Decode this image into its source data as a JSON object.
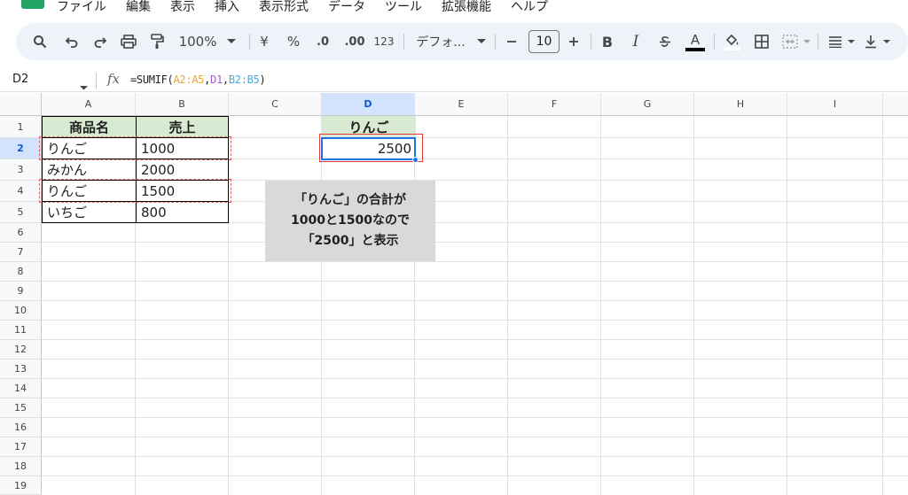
{
  "menu": {
    "items": [
      "ファイル",
      "編集",
      "表示",
      "挿入",
      "表示形式",
      "データ",
      "ツール",
      "拡張機能",
      "ヘルプ"
    ]
  },
  "toolbar": {
    "zoom": "100%",
    "currency": "¥",
    "percent": "%",
    "dec_decrease": ".0",
    "dec_increase": ".00",
    "number_format": "123",
    "font": "デフォ...",
    "font_size": "10",
    "bold": "B",
    "italic": "I",
    "text_color_label": "A",
    "accent_color": "#0b57d0"
  },
  "formula_bar": {
    "name_box": "D2",
    "fx": "fx",
    "formula_prefix": "=SUMIF(",
    "arg1": "A2:A5",
    "comma1": ",",
    "arg2": "D1",
    "comma2": ",",
    "arg3": "B2:B5",
    "formula_suffix": ")"
  },
  "columns": [
    "A",
    "B",
    "C",
    "D",
    "E",
    "F",
    "G",
    "H",
    "I"
  ],
  "rows": [
    "1",
    "2",
    "3",
    "4",
    "5",
    "6",
    "7",
    "8",
    "9",
    "10",
    "11",
    "12",
    "13",
    "14",
    "15",
    "16",
    "17",
    "18",
    "19"
  ],
  "selected_cell": "D2",
  "table": {
    "headers": [
      "商品名",
      "売上"
    ],
    "rows": [
      [
        "りんご",
        "1000"
      ],
      [
        "みかん",
        "2000"
      ],
      [
        "りんご",
        "1500"
      ],
      [
        "いちご",
        "800"
      ]
    ]
  },
  "criteria_header": "りんご",
  "result_value": "2500",
  "note": {
    "line1": "「りんご」の合計が",
    "line2": "1000と1500なので",
    "line3": "「2500」と表示"
  }
}
